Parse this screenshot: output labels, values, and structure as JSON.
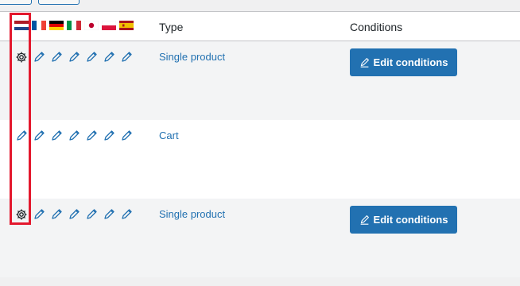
{
  "header": {
    "type_label": "Type",
    "conditions_label": "Conditions",
    "flags": [
      "flag-nl-icon",
      "flag-fr-icon",
      "flag-de-icon",
      "flag-it-icon",
      "flag-jp-icon",
      "flag-pl-icon",
      "flag-es-icon"
    ]
  },
  "rows": [
    {
      "type": "Single product",
      "first_icon": "gear-icon",
      "button_label": "Edit conditions"
    },
    {
      "type": "Cart",
      "first_icon": "pencil-icon",
      "button_label": ""
    },
    {
      "type": "Single product",
      "first_icon": "gear-icon",
      "button_label": "Edit conditions"
    }
  ],
  "colors": {
    "accent": "#2271b1",
    "highlight": "#e3182d"
  }
}
